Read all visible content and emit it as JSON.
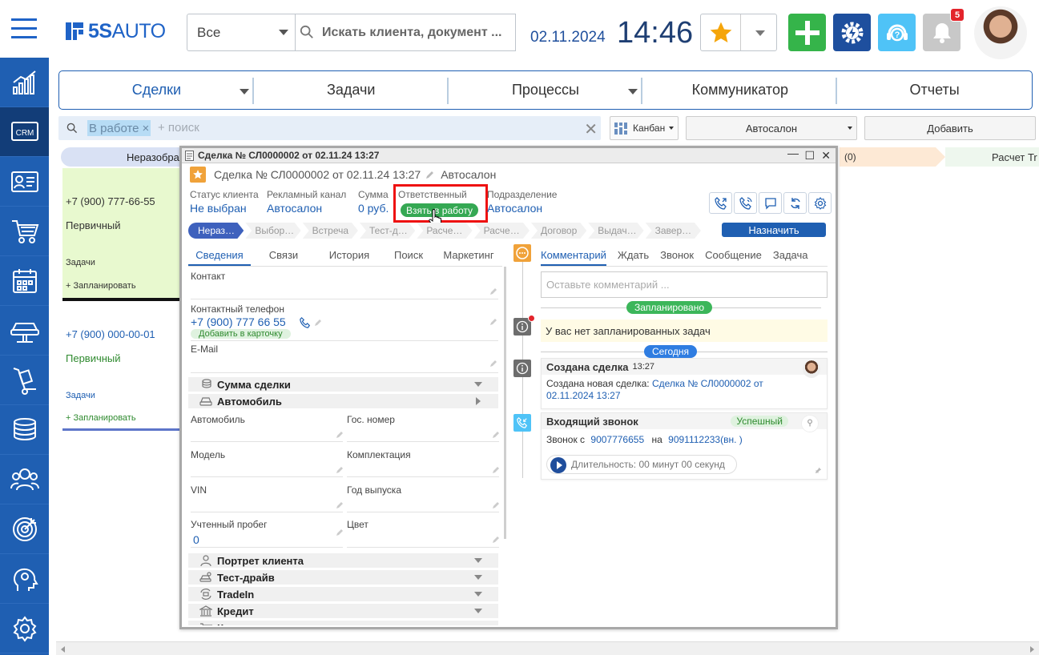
{
  "header": {
    "logo_text_bold": "5S",
    "logo_text_light": "AUTO",
    "scope_select": "Все",
    "search_placeholder": "Искать клиента, документ ...",
    "date": "02.11.2024",
    "time": "14:46",
    "notifications_count": "5",
    "colors": {
      "brand": "#1f5fb2",
      "add": "#35b44a",
      "settings": "#1e4f9e",
      "support": "#4fc3f7",
      "bell": "#c2c2c2"
    }
  },
  "sidebar": {
    "items": [
      {
        "icon": "analytics-chart-icon"
      },
      {
        "icon": "crm-icon",
        "label": "CRM",
        "active": true
      },
      {
        "icon": "contacts-card-icon"
      },
      {
        "icon": "shopping-cart-icon"
      },
      {
        "icon": "calendar-icon"
      },
      {
        "icon": "car-lift-icon"
      },
      {
        "icon": "parts-cart-icon"
      },
      {
        "icon": "coins-stack-icon"
      },
      {
        "icon": "staff-group-icon"
      },
      {
        "icon": "target-icon"
      },
      {
        "icon": "head-ai-icon"
      },
      {
        "icon": "gear-icon"
      }
    ]
  },
  "mainnav": {
    "tabs": [
      {
        "label": "Сделки",
        "active": true,
        "dropdown": true
      },
      {
        "label": "Задачи"
      },
      {
        "label": "Процессы",
        "dropdown": true
      },
      {
        "label": "Коммуникатор"
      },
      {
        "label": "Отчеты"
      }
    ]
  },
  "filter": {
    "chip": "В работе",
    "placeholder": "+ поиск",
    "view": "Канбан",
    "department": "Автосалон",
    "add": "Добавить"
  },
  "kanban": {
    "stage_left": "Неразобра",
    "stage_right_count": "(0)",
    "stage_right2": "Расчет Tr",
    "cards": [
      {
        "phone": "+7 (900) 777-66-55",
        "status": "Первичный",
        "tasks": "Задачи",
        "plan": "+ Запланировать"
      },
      {
        "phone": "+7 (900) 000-00-01",
        "status": "Первичный",
        "tasks": "Задачи",
        "plan": "+ Запланировать"
      }
    ]
  },
  "modal": {
    "window_title": "Сделка № СЛ0000002 от 02.11.24 13:27",
    "header_title": "Сделка № СЛ0000002 от 02.11.24 13:27",
    "header_dept": "Автосалон",
    "fields": {
      "client_status_label": "Статус клиента",
      "client_status_value": "Не выбран",
      "ad_channel_label": "Рекламный канал",
      "ad_channel_value": "Автосалон",
      "sum_label": "Сумма",
      "sum_value": "0 руб.",
      "responsible_label": "Ответственный",
      "take_button": "Взять в работу",
      "division_label": "Подразделение",
      "division_value": "Автосалон"
    },
    "pipeline": [
      "Нераз…",
      "Выбор…",
      "Встреча",
      "Тест-д…",
      "Расче…",
      "Расче…",
      "Договор",
      "Выдач…",
      "Завер…"
    ],
    "assign_button": "Назначить",
    "left_tabs": [
      "Сведения",
      "Связи",
      "История",
      "Поиск",
      "Маркетинг"
    ],
    "info": {
      "contact_label": "Контакт",
      "phone_label": "Контактный телефон",
      "phone_value": "+7 (900) 777 66 55",
      "add_to_card": "Добавить в карточку",
      "email_label": "E-Mail",
      "section_sum": "Сумма сделки",
      "section_car": "Автомобиль",
      "car_label": "Автомобиль",
      "plate_label": "Гос. номер",
      "model_label": "Модель",
      "trim_label": "Комплектация",
      "vin_label": "VIN",
      "year_label": "Год выпуска",
      "mileage_label": "Учтенный пробег",
      "mileage_value": "0",
      "color_label": "Цвет",
      "section_portrait": "Портрет клиента",
      "section_testdrive": "Тест-драйв",
      "section_tradein": "TradeIn",
      "section_credit": "Кредит",
      "section_more": "К"
    },
    "right_tabs": [
      "Комментарий",
      "Ждать",
      "Звонок",
      "Сообщение",
      "Задача"
    ],
    "comment_placeholder": "Оставьте комментарий ...",
    "planned_label": "Запланировано",
    "no_tasks": "У вас нет запланированных задач",
    "today_label": "Сегодня",
    "created_event": {
      "title": "Создана сделка",
      "time": "13:27",
      "text": "Создана новая сделка:",
      "link": "Сделка № СЛ0000002 от 02.11.2024 13:27"
    },
    "call_event": {
      "title": "Входящий звонок",
      "status": "Успешный",
      "from_prefix": "Звонок с",
      "from": "9007776655",
      "to_prefix": "на",
      "to": "9091112233(вн. )",
      "duration": "Длительность: 00 минут 00 секунд"
    }
  }
}
